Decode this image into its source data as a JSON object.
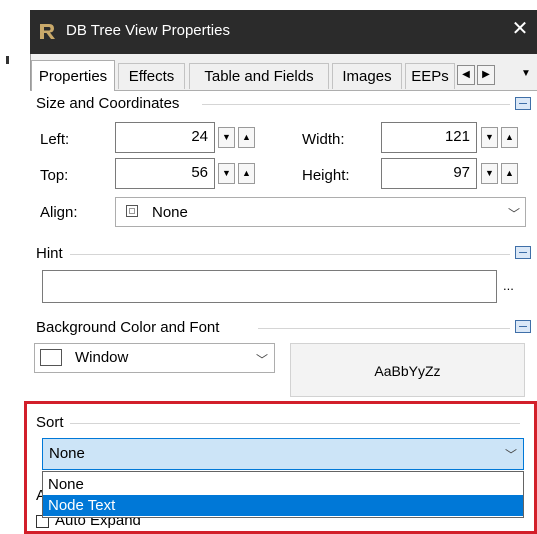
{
  "window": {
    "title": "DB Tree View Properties",
    "close_glyph": "✕",
    "colors": {
      "titlebar": "#2b2b2b",
      "selection": "#0078d7",
      "highlight_box": "#d21f2a"
    }
  },
  "tabs": [
    {
      "label": "Properties",
      "active": true
    },
    {
      "label": "Effects"
    },
    {
      "label": "Table and Fields"
    },
    {
      "label": "Images"
    },
    {
      "label": "EEPs"
    }
  ],
  "tab_nav": {
    "prev": "◀",
    "next": "▶",
    "menu": "▼"
  },
  "size_coords": {
    "header": "Size and Coordinates",
    "left_label": "Left:",
    "left_value": "24",
    "top_label": "Top:",
    "top_value": "56",
    "width_label": "Width:",
    "width_value": "121",
    "height_label": "Height:",
    "height_value": "97",
    "align_label": "Align:",
    "align_value": "None"
  },
  "hint": {
    "header": "Hint",
    "value": "",
    "ellipsis": "..."
  },
  "bg_font": {
    "header": "Background Color and Font",
    "color_value": "Window",
    "sample_text": "AaBbYyZz"
  },
  "sort": {
    "header": "Sort",
    "value": "None",
    "options": [
      "None",
      "Node Text"
    ],
    "highlighted_option": "Node Text"
  },
  "hidden_group": {
    "header_fragment": "A",
    "auto_expand_label": "Auto Expand"
  }
}
